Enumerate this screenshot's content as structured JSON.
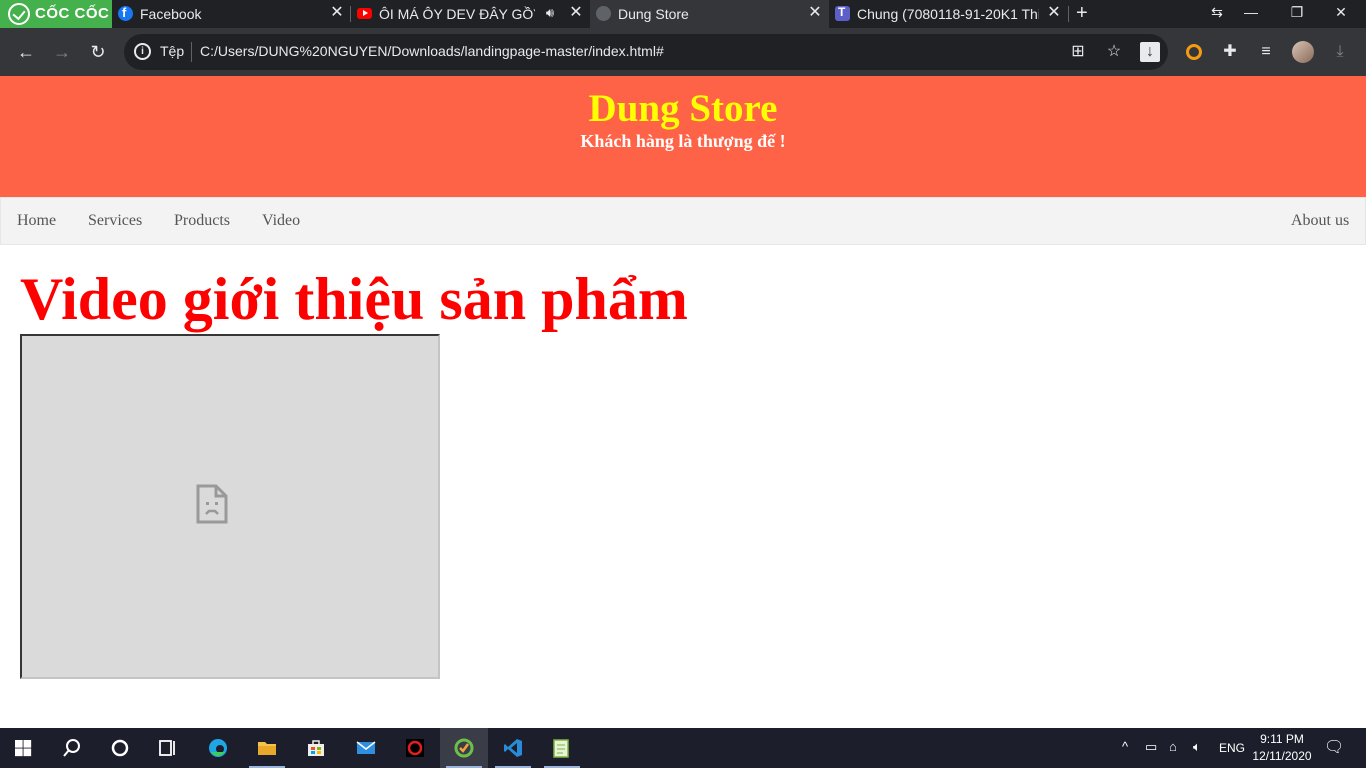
{
  "browser": {
    "brand": {
      "label": "CỐC CỐC"
    },
    "tabs": [
      {
        "title": "Facebook",
        "icon": "facebook-icon"
      },
      {
        "title": "ÔI MÁ ÔY DEV ĐÂY GỒY -",
        "icon": "youtube-icon"
      },
      {
        "title": "Dung Store",
        "icon": "globe-icon"
      },
      {
        "title": "Chung (7080118-91-20K1 Thi",
        "icon": "teams-icon"
      }
    ],
    "address_bar": {
      "scheme_label": "Tệp",
      "url": "C:/Users/DUNG%20NGUYEN/Downloads/landingpage-master/index.html#"
    }
  },
  "site": {
    "title": "Dung Store",
    "slogan": "Khách hàng là thượng đế !",
    "nav": {
      "left": [
        "Home",
        "Services",
        "Products",
        "Video"
      ],
      "right": "About us"
    },
    "heading": "Video giới thiệu sản phẩm",
    "colors": {
      "header_bg": "#ff6347",
      "title": "#ffff00",
      "heading": "#ff0000"
    }
  },
  "taskbar": {
    "language": "ENG",
    "time": "9:11 PM",
    "date": "12/11/2020"
  }
}
